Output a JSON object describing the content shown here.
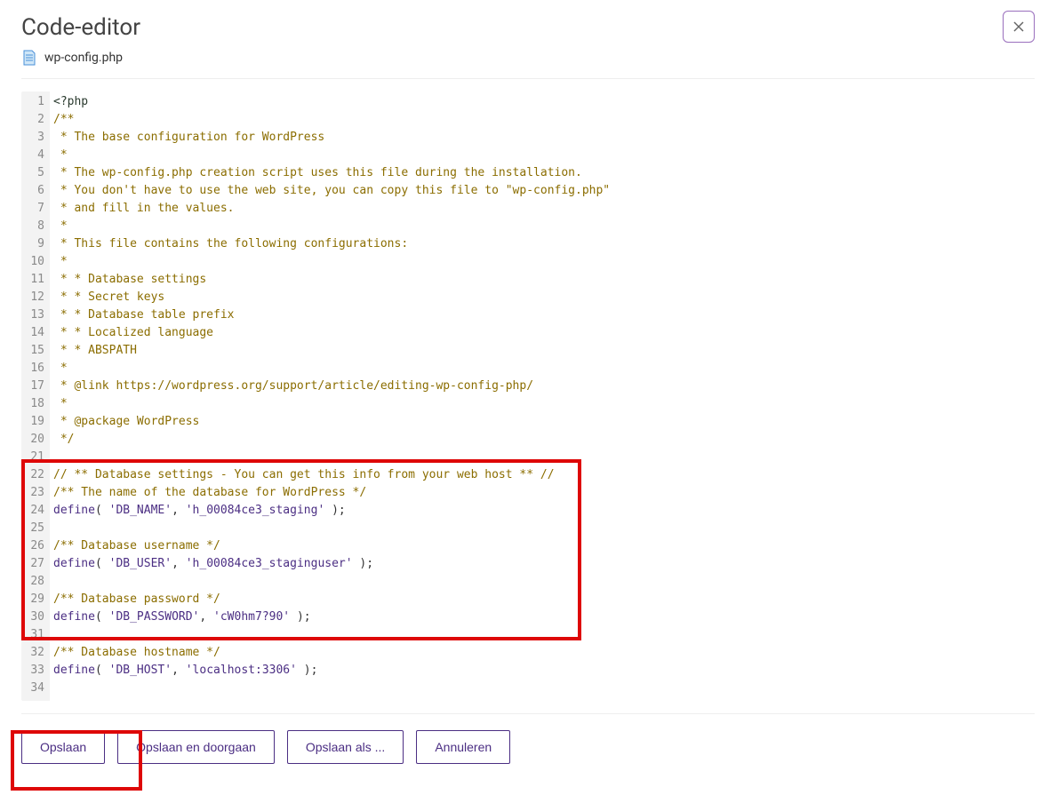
{
  "header": {
    "title": "Code-editor",
    "filename": "wp-config.php"
  },
  "code": {
    "lines": [
      {
        "n": 1,
        "segs": [
          {
            "cls": "c-tag",
            "t": "<?php"
          }
        ]
      },
      {
        "n": 2,
        "segs": [
          {
            "cls": "c-comment",
            "t": "/**"
          }
        ]
      },
      {
        "n": 3,
        "segs": [
          {
            "cls": "c-comment",
            "t": " * The base configuration for WordPress"
          }
        ]
      },
      {
        "n": 4,
        "segs": [
          {
            "cls": "c-comment",
            "t": " *"
          }
        ]
      },
      {
        "n": 5,
        "segs": [
          {
            "cls": "c-comment",
            "t": " * The wp-config.php creation script uses this file during the installation."
          }
        ]
      },
      {
        "n": 6,
        "segs": [
          {
            "cls": "c-comment",
            "t": " * You don't have to use the web site, you can copy this file to \"wp-config.php\""
          }
        ]
      },
      {
        "n": 7,
        "segs": [
          {
            "cls": "c-comment",
            "t": " * and fill in the values."
          }
        ]
      },
      {
        "n": 8,
        "segs": [
          {
            "cls": "c-comment",
            "t": " *"
          }
        ]
      },
      {
        "n": 9,
        "segs": [
          {
            "cls": "c-comment",
            "t": " * This file contains the following configurations:"
          }
        ]
      },
      {
        "n": 10,
        "segs": [
          {
            "cls": "c-comment",
            "t": " *"
          }
        ]
      },
      {
        "n": 11,
        "segs": [
          {
            "cls": "c-comment",
            "t": " * * Database settings"
          }
        ]
      },
      {
        "n": 12,
        "segs": [
          {
            "cls": "c-comment",
            "t": " * * Secret keys"
          }
        ]
      },
      {
        "n": 13,
        "segs": [
          {
            "cls": "c-comment",
            "t": " * * Database table prefix"
          }
        ]
      },
      {
        "n": 14,
        "segs": [
          {
            "cls": "c-comment",
            "t": " * * Localized language"
          }
        ]
      },
      {
        "n": 15,
        "segs": [
          {
            "cls": "c-comment",
            "t": " * * ABSPATH"
          }
        ]
      },
      {
        "n": 16,
        "segs": [
          {
            "cls": "c-comment",
            "t": " *"
          }
        ]
      },
      {
        "n": 17,
        "segs": [
          {
            "cls": "c-comment",
            "t": " * @link https://wordpress.org/support/article/editing-wp-config-php/"
          }
        ]
      },
      {
        "n": 18,
        "segs": [
          {
            "cls": "c-comment",
            "t": " *"
          }
        ]
      },
      {
        "n": 19,
        "segs": [
          {
            "cls": "c-comment",
            "t": " * @package WordPress"
          }
        ]
      },
      {
        "n": 20,
        "segs": [
          {
            "cls": "c-comment",
            "t": " */"
          }
        ]
      },
      {
        "n": 21,
        "segs": [
          {
            "cls": "c-plain",
            "t": ""
          }
        ]
      },
      {
        "n": 22,
        "segs": [
          {
            "cls": "c-comment",
            "t": "// ** Database settings - You can get this info from your web host ** //"
          }
        ]
      },
      {
        "n": 23,
        "segs": [
          {
            "cls": "c-comment",
            "t": "/** The name of the database for WordPress */"
          }
        ]
      },
      {
        "n": 24,
        "segs": [
          {
            "cls": "c-keyword",
            "t": "define"
          },
          {
            "cls": "c-plain",
            "t": "( "
          },
          {
            "cls": "c-string",
            "t": "'DB_NAME'"
          },
          {
            "cls": "c-plain",
            "t": ", "
          },
          {
            "cls": "c-string",
            "t": "'h_00084ce3_staging'"
          },
          {
            "cls": "c-plain",
            "t": " );"
          }
        ]
      },
      {
        "n": 25,
        "segs": [
          {
            "cls": "c-plain",
            "t": ""
          }
        ]
      },
      {
        "n": 26,
        "segs": [
          {
            "cls": "c-comment",
            "t": "/** Database username */"
          }
        ]
      },
      {
        "n": 27,
        "segs": [
          {
            "cls": "c-keyword",
            "t": "define"
          },
          {
            "cls": "c-plain",
            "t": "( "
          },
          {
            "cls": "c-string",
            "t": "'DB_USER'"
          },
          {
            "cls": "c-plain",
            "t": ", "
          },
          {
            "cls": "c-string",
            "t": "'h_00084ce3_staginguser'"
          },
          {
            "cls": "c-plain",
            "t": " );"
          }
        ]
      },
      {
        "n": 28,
        "segs": [
          {
            "cls": "c-plain",
            "t": ""
          }
        ]
      },
      {
        "n": 29,
        "segs": [
          {
            "cls": "c-comment",
            "t": "/** Database password */"
          }
        ]
      },
      {
        "n": 30,
        "segs": [
          {
            "cls": "c-keyword",
            "t": "define"
          },
          {
            "cls": "c-plain",
            "t": "( "
          },
          {
            "cls": "c-string",
            "t": "'DB_PASSWORD'"
          },
          {
            "cls": "c-plain",
            "t": ", "
          },
          {
            "cls": "c-string",
            "t": "'cW0hm7?90'"
          },
          {
            "cls": "c-plain",
            "t": " );"
          }
        ]
      },
      {
        "n": 31,
        "segs": [
          {
            "cls": "c-plain",
            "t": ""
          }
        ]
      },
      {
        "n": 32,
        "segs": [
          {
            "cls": "c-comment",
            "t": "/** Database hostname */"
          }
        ]
      },
      {
        "n": 33,
        "segs": [
          {
            "cls": "c-keyword",
            "t": "define"
          },
          {
            "cls": "c-plain",
            "t": "( "
          },
          {
            "cls": "c-string",
            "t": "'DB_HOST'"
          },
          {
            "cls": "c-plain",
            "t": ", "
          },
          {
            "cls": "c-string",
            "t": "'localhost:3306'"
          },
          {
            "cls": "c-plain",
            "t": " );"
          }
        ]
      },
      {
        "n": 34,
        "segs": [
          {
            "cls": "c-plain",
            "t": ""
          }
        ]
      }
    ]
  },
  "footer": {
    "save": "Opslaan",
    "save_continue": "Opslaan en doorgaan",
    "save_as": "Opslaan als ...",
    "cancel": "Annuleren"
  }
}
